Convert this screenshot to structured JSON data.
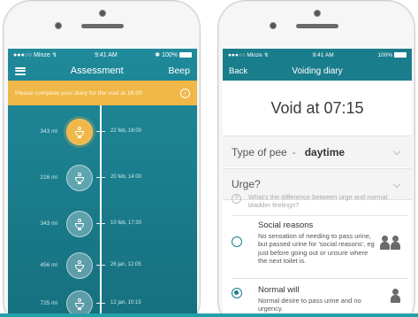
{
  "left_screen": {
    "status": {
      "carrier": "●●●○○ Minze ↯",
      "time": "9:41 AM",
      "battery": "✱ 100%"
    },
    "nav": {
      "title": "Assessment",
      "right_label": "Beep"
    },
    "banner": {
      "text": "Please complete your diary for the void at 16:00"
    },
    "entries": [
      {
        "volume": "343 ml",
        "date": "22 feb, 16:00",
        "active": true
      },
      {
        "volume": "216 ml",
        "date": "20 feb, 14:00",
        "active": false
      },
      {
        "volume": "343 ml",
        "date": "10 feb, 17:30",
        "active": false
      },
      {
        "volume": "456 ml",
        "date": "26 jan, 12:05",
        "active": false
      },
      {
        "volume": "725 ml",
        "date": "12 jan, 10:15",
        "active": false
      }
    ]
  },
  "right_screen": {
    "status": {
      "carrier": "●●●○○ Minze ↯",
      "time": "9:41 AM",
      "battery": "100%"
    },
    "nav": {
      "back": "Back",
      "title": "Voiding diary"
    },
    "void_title": "Void at 07:15",
    "type_row": {
      "label": "Type of pee",
      "separator": "-",
      "value": "daytime"
    },
    "urge_row": {
      "label": "Urge?"
    },
    "help_text": "What's the difference between urge and normal bladder feelings?",
    "options": [
      {
        "title": "Social reasons",
        "description": "No sensation of needing to pass urine, but passed urine for 'social reasons', eg just before going out or unsure where the next toilet is.",
        "selected": false,
        "icon": "two-people-icon"
      },
      {
        "title": "Normal will",
        "description": "Normal desire to pass urine and no urgency.",
        "selected": true,
        "icon": "person-icon"
      }
    ]
  },
  "colors": {
    "teal": "#1a7d8c",
    "banner": "#f0b848",
    "accent_strip": "#22a2a8"
  }
}
